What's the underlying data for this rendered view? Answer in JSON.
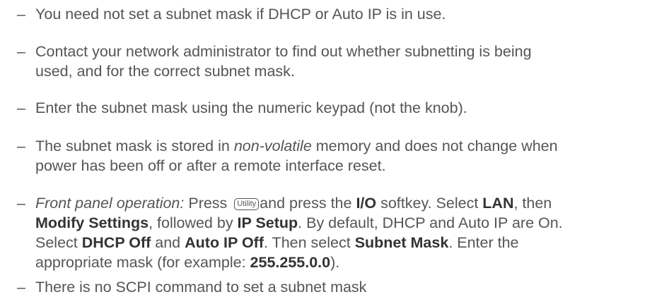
{
  "dash": "–",
  "items": [
    {
      "text": "You need not set a subnet mask if DHCP or Auto IP is in use."
    },
    {
      "line1": "Contact your network administrator to find out whether subnetting is being",
      "line2": "used, and for the correct subnet mask."
    },
    {
      "text": "Enter the subnet mask using the numeric keypad (not the knob)."
    },
    {
      "prefix": "The subnet mask is stored in ",
      "emph": "non-volatile",
      "suffix": " memory and does not change when",
      "line2": "power has been off or after a remote interface reset."
    },
    {
      "front_label": "Front panel operation:",
      "press": " Press ",
      "key": "Utility",
      "and_press": "and press the ",
      "io": "I/O",
      "softkey_select": " softkey. Select ",
      "lan": "LAN",
      "then": ", then",
      "modify": "Modify Settings",
      "followed": ", followed by ",
      "ipsetup": "IP Setup",
      "default": ". By default, DHCP and Auto IP are On.",
      "select": "Select ",
      "dhcpoff": "DHCP Off",
      "and": " and ",
      "autoipoff": "Auto IP Off",
      "then_select": ". Then select ",
      "subnetmask": "Subnet Mask",
      "enter": ". Enter the",
      "appropriate": "appropriate mask (for example: ",
      "example": "255.255.0.0",
      "close": ")."
    },
    {
      "text": "There is no SCPI command to set a subnet mask"
    }
  ]
}
